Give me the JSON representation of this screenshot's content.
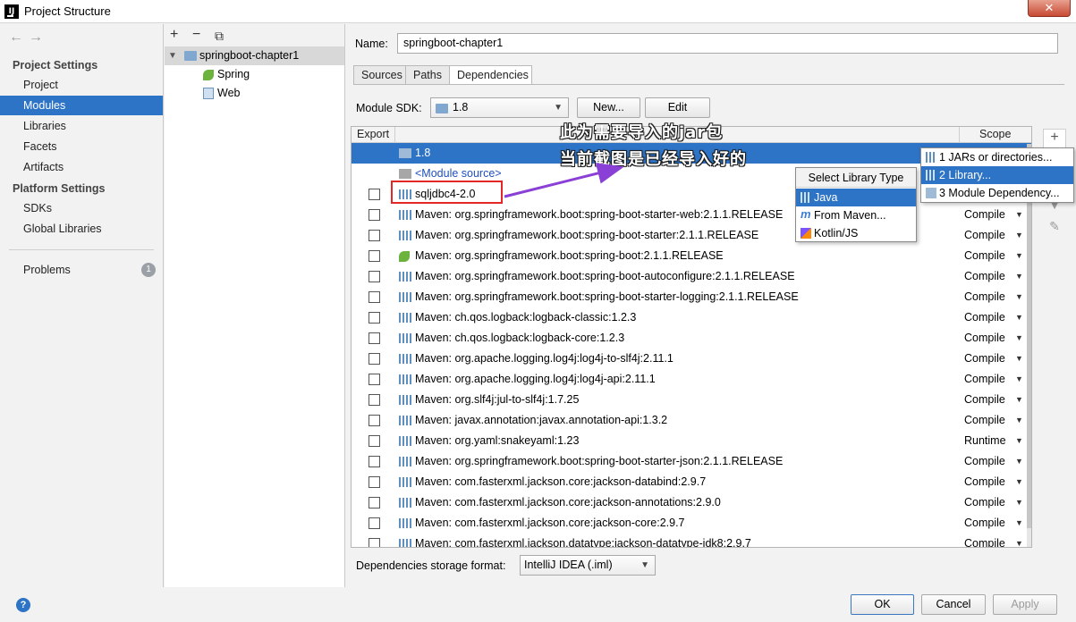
{
  "window": {
    "title": "Project Structure",
    "app_icon": "IJ",
    "close": "✕"
  },
  "nav": {
    "project_settings_header": "Project Settings",
    "project_settings_items": [
      "Project",
      "Modules",
      "Libraries",
      "Facets",
      "Artifacts"
    ],
    "platform_settings_header": "Platform Settings",
    "platform_settings_items": [
      "SDKs",
      "Global Libraries"
    ],
    "problems_label": "Problems",
    "problems_count": "1",
    "selected": "Modules"
  },
  "tree": {
    "toolbar": {
      "add": "+",
      "remove": "−",
      "copy": "⧉"
    },
    "root": "springboot-chapter1",
    "children": [
      "Spring",
      "Web"
    ]
  },
  "module": {
    "name_label": "Name:",
    "name_value": "springboot-chapter1",
    "tabs": [
      "Sources",
      "Paths",
      "Dependencies"
    ],
    "active_tab": "Dependencies",
    "sdk_label": "Module SDK:",
    "sdk_value": "1.8",
    "new_button": "New...",
    "edit_button": "Edit"
  },
  "dependencies": {
    "header_export": "Export",
    "header_scope": "Scope",
    "sdk_row": "1.8",
    "module_source_row": "<Module source>",
    "rows": [
      {
        "name": "sqljdbc4-2.0",
        "scope": "",
        "icon": "library-icon"
      },
      {
        "name": "Maven: org.springframework.boot:spring-boot-starter-web:2.1.1.RELEASE",
        "scope": "Compile",
        "icon": "library-icon"
      },
      {
        "name": "Maven: org.springframework.boot:spring-boot-starter:2.1.1.RELEASE",
        "scope": "Compile",
        "icon": "library-icon"
      },
      {
        "name": "Maven: org.springframework.boot:spring-boot:2.1.1.RELEASE",
        "scope": "Compile",
        "icon": "spring-icon"
      },
      {
        "name": "Maven: org.springframework.boot:spring-boot-autoconfigure:2.1.1.RELEASE",
        "scope": "Compile",
        "icon": "library-icon"
      },
      {
        "name": "Maven: org.springframework.boot:spring-boot-starter-logging:2.1.1.RELEASE",
        "scope": "Compile",
        "icon": "library-icon"
      },
      {
        "name": "Maven: ch.qos.logback:logback-classic:1.2.3",
        "scope": "Compile",
        "icon": "library-icon"
      },
      {
        "name": "Maven: ch.qos.logback:logback-core:1.2.3",
        "scope": "Compile",
        "icon": "library-icon"
      },
      {
        "name": "Maven: org.apache.logging.log4j:log4j-to-slf4j:2.11.1",
        "scope": "Compile",
        "icon": "library-icon"
      },
      {
        "name": "Maven: org.apache.logging.log4j:log4j-api:2.11.1",
        "scope": "Compile",
        "icon": "library-icon"
      },
      {
        "name": "Maven: org.slf4j:jul-to-slf4j:1.7.25",
        "scope": "Compile",
        "icon": "library-icon"
      },
      {
        "name": "Maven: javax.annotation:javax.annotation-api:1.3.2",
        "scope": "Compile",
        "icon": "library-icon"
      },
      {
        "name": "Maven: org.yaml:snakeyaml:1.23",
        "scope": "Runtime",
        "icon": "library-icon"
      },
      {
        "name": "Maven: org.springframework.boot:spring-boot-starter-json:2.1.1.RELEASE",
        "scope": "Compile",
        "icon": "library-icon"
      },
      {
        "name": "Maven: com.fasterxml.jackson.core:jackson-databind:2.9.7",
        "scope": "Compile",
        "icon": "library-icon"
      },
      {
        "name": "Maven: com.fasterxml.jackson.core:jackson-annotations:2.9.0",
        "scope": "Compile",
        "icon": "library-icon"
      },
      {
        "name": "Maven: com.fasterxml.jackson.core:jackson-core:2.9.7",
        "scope": "Compile",
        "icon": "library-icon"
      },
      {
        "name": "Maven: com.fasterxml.jackson.datatype:jackson-datatype-jdk8:2.9.7",
        "scope": "Compile",
        "icon": "library-icon"
      }
    ]
  },
  "annotations": {
    "line1": "此为需要导入的jar包",
    "line2": "当前截图是已经导入好的"
  },
  "popup_add": {
    "items": [
      "1  JARs or directories...",
      "2  Library...",
      "3  Module Dependency..."
    ],
    "selected": "2  Library..."
  },
  "popup_library_type": {
    "title": "Select Library Type",
    "items": [
      "Java",
      "From Maven...",
      "Kotlin/JS"
    ],
    "selected": "Java"
  },
  "storage": {
    "label": "Dependencies storage format:",
    "value": "IntelliJ IDEA (.iml)"
  },
  "footer": {
    "help": "?",
    "ok": "OK",
    "cancel": "Cancel",
    "apply": "Apply"
  },
  "colors": {
    "selection": "#2d73c6",
    "annotation_box": "#e32626",
    "arrow": "#8a3fd6"
  }
}
